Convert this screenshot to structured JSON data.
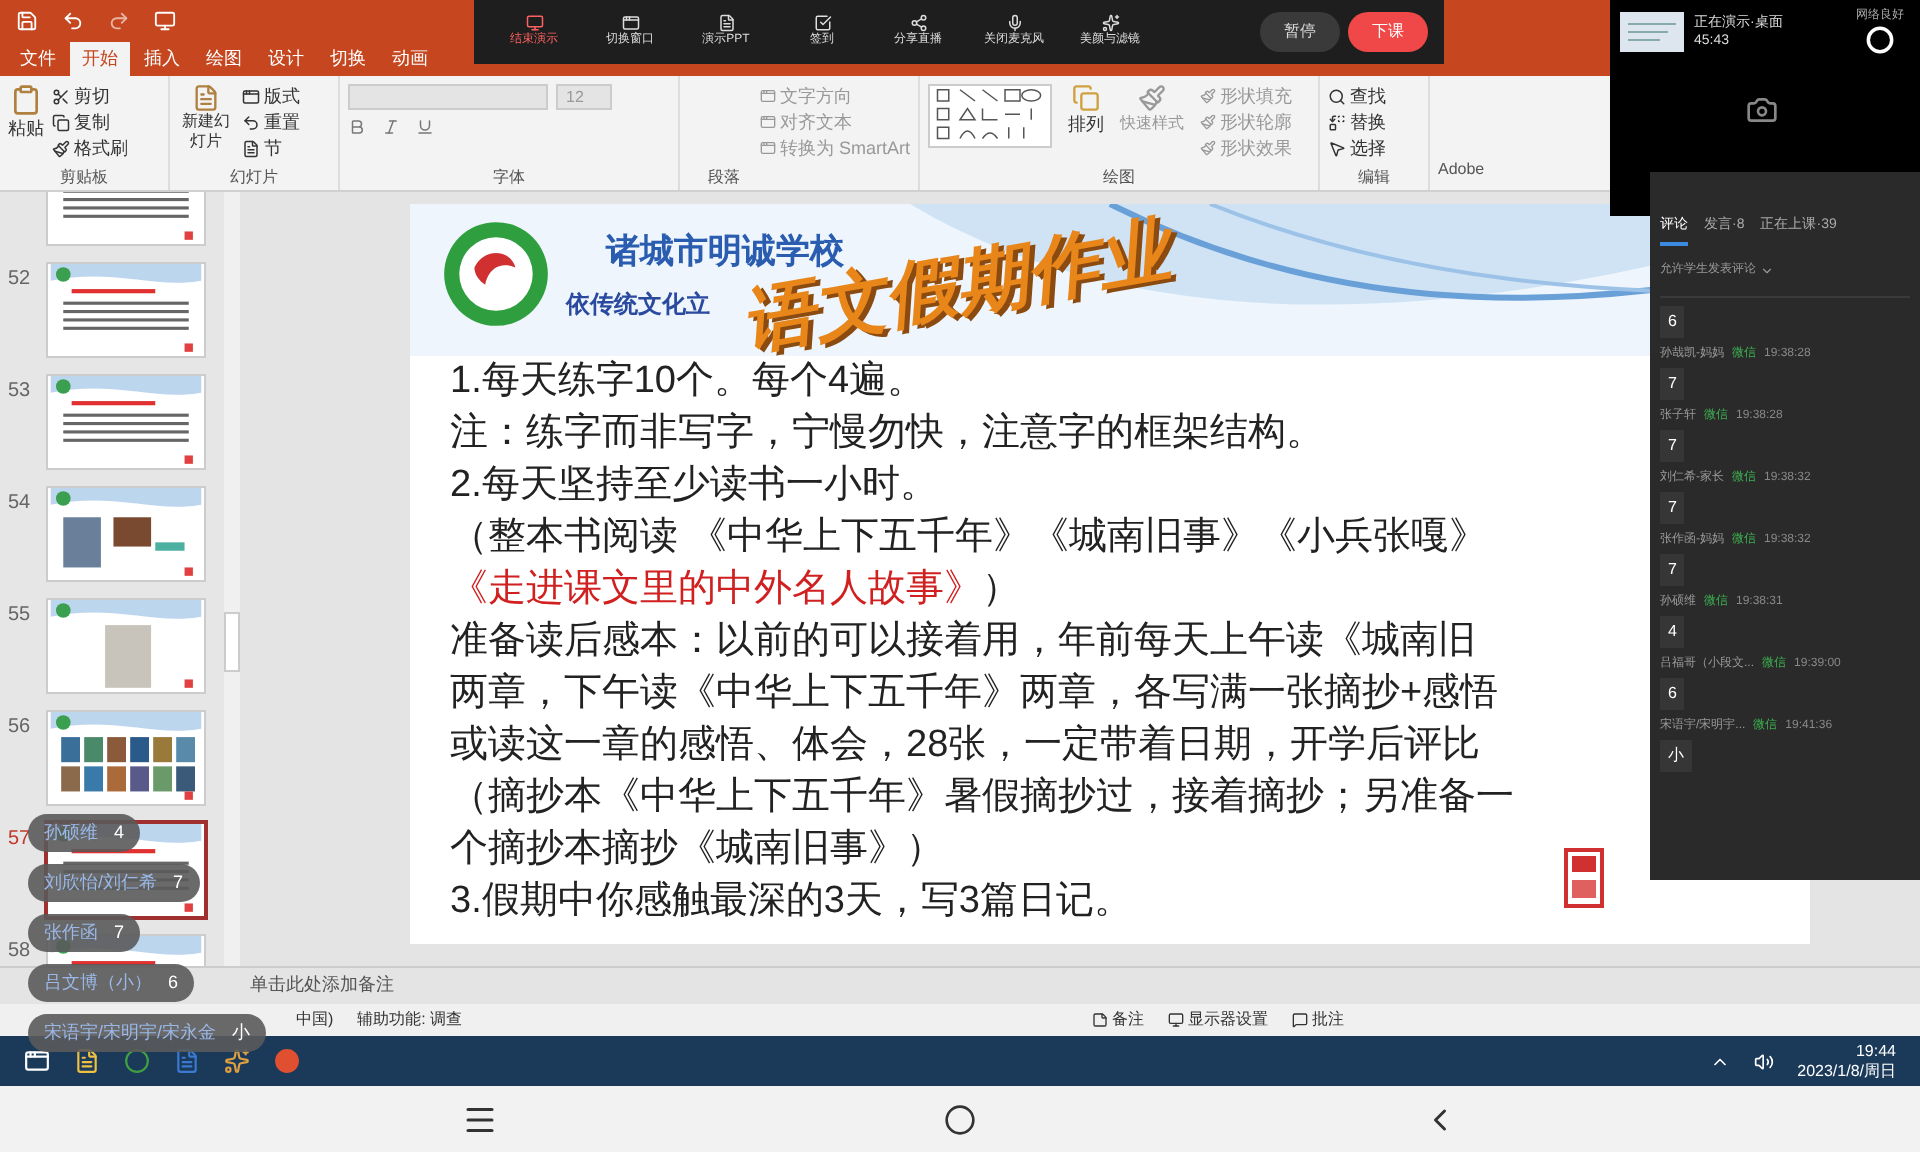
{
  "ribbon_tabs": [
    {
      "label": "文件",
      "selected": false
    },
    {
      "label": "开始",
      "selected": true
    },
    {
      "label": "插入",
      "selected": false
    },
    {
      "label": "绘图",
      "selected": false
    },
    {
      "label": "设计",
      "selected": false
    },
    {
      "label": "切换",
      "selected": false
    },
    {
      "label": "动画",
      "selected": false
    }
  ],
  "live_toolbar": {
    "buttons": [
      {
        "label": "结束演示",
        "kind": "alert"
      },
      {
        "label": "切换窗口",
        "kind": "normal"
      },
      {
        "label": "演示PPT",
        "kind": "normal"
      },
      {
        "label": "签到",
        "kind": "normal"
      },
      {
        "label": "分享直播",
        "kind": "normal"
      },
      {
        "label": "关闭麦克风",
        "kind": "normal"
      },
      {
        "label": "美颜与滤镜",
        "kind": "normal"
      }
    ],
    "pause": "暂停",
    "end_class": "下课"
  },
  "ribbon": {
    "clipboard": {
      "label": "剪贴板",
      "paste": "粘贴",
      "cut": "剪切",
      "copy": "复制",
      "format_painter": "格式刷"
    },
    "slides": {
      "label": "幻灯片",
      "new_slide": "新建幻灯片",
      "layout": "版式",
      "reset": "重置",
      "section": "节"
    },
    "font": {
      "label": "字体",
      "size": "12"
    },
    "paragraph": {
      "label": "段落",
      "text_direction": "文字方向",
      "align_text": "对齐文本",
      "smartart": "转换为 SmartArt"
    },
    "drawing": {
      "label": "绘图",
      "arrange": "排列",
      "quick_styles": "快速样式",
      "fill": "形状填充",
      "outline": "形状轮廓",
      "effects": "形状效果"
    },
    "editing": {
      "label": "编辑",
      "find": "查找",
      "replace": "替换",
      "select": "选择"
    },
    "adobe": "Adobe"
  },
  "thumbnails": [
    {
      "kind": "text",
      "selected": false
    },
    {
      "number": "52",
      "kind": "text",
      "selected": false
    },
    {
      "number": "53",
      "kind": "text",
      "selected": false
    },
    {
      "number": "54",
      "kind": "photo",
      "selected": false
    },
    {
      "number": "55",
      "kind": "table",
      "selected": false
    },
    {
      "number": "56",
      "kind": "gallery",
      "selected": false
    },
    {
      "number": "57",
      "kind": "text",
      "selected": true
    },
    {
      "number": "58",
      "kind": "text",
      "selected": false
    }
  ],
  "slide": {
    "school": "诸城市明诚学校",
    "motto": "依传统文化立",
    "title": "语文假期作业",
    "lines": [
      {
        "text": "1.每天练字10个。每个4遍。",
        "kind": "normal"
      },
      {
        "text": "注：练字而非写字，宁慢勿快，注意字的框架结构。",
        "kind": "normal"
      },
      {
        "text": "2.每天坚持至少读书一小时。",
        "kind": "normal"
      },
      {
        "text": "（整本书阅读 《中华上下五千年》《城南旧事》《小兵张嘎》",
        "kind": "normal"
      },
      {
        "text": "《走进课文里的中外名人故事》",
        "kind": "red",
        "tail": "）"
      },
      {
        "text": "准备读后感本：以前的可以接着用，年前每天上午读《城南旧",
        "kind": "normal"
      },
      {
        "text": "两章，下午读《中华上下五千年》两章，各写满一张摘抄+感悟",
        "kind": "normal"
      },
      {
        "text": "或读这一章的感悟、体会，28张，一定带着日期，开学后评比",
        "kind": "normal"
      },
      {
        "text": "（摘抄本《中华上下五千年》暑假摘抄过，接着摘抄；另准备一",
        "kind": "normal"
      },
      {
        "text": "个摘抄本摘抄《城南旧事》）",
        "kind": "normal"
      },
      {
        "text": "3.假期中你感触最深的3天，写3篇日记。",
        "kind": "normal"
      }
    ]
  },
  "notes_placeholder": "单击此处添加备注",
  "status_bar": {
    "language": "中国)",
    "accessibility": "辅助功能: 调查",
    "notes": "备注",
    "display": "显示器设置",
    "comments": "批注"
  },
  "taskbar": {
    "time": "19:44",
    "date": "2023/1/8/周日"
  },
  "presenter": {
    "status": "正在演示·桌面",
    "timer": "45:43",
    "network": "网络良好"
  },
  "comment_panel": {
    "tabs": [
      {
        "label": "评论",
        "selected": true
      },
      {
        "label": "发言·8",
        "selected": false
      },
      {
        "label": "正在上课·39",
        "selected": false
      }
    ],
    "filter": "允许学生发表评论",
    "comments": [
      {
        "text": "6"
      },
      {
        "name": "孙哉凯-妈妈",
        "tag": "微信",
        "time": "19:38:28",
        "text": "7"
      },
      {
        "name": "张子轩",
        "tag": "微信",
        "time": "19:38:28",
        "text": "7"
      },
      {
        "name": "刘仁希-家长",
        "tag": "微信",
        "time": "19:38:32",
        "text": "7"
      },
      {
        "name": "张作函-妈妈",
        "tag": "微信",
        "time": "19:38:32",
        "text": "7"
      },
      {
        "name": "孙硕维",
        "tag": "微信",
        "time": "19:38:31",
        "text": "4"
      },
      {
        "name": "吕福哥（小段文...",
        "tag": "微信",
        "time": "19:39:00",
        "text": "6"
      },
      {
        "name": "宋语宇/宋明宇...",
        "tag": "微信",
        "time": "19:41:36",
        "text": "小"
      }
    ]
  },
  "bubbles": [
    {
      "name": "孙硕维",
      "text": "4"
    },
    {
      "name": "刘欣怡/刘仁希",
      "text": "7"
    },
    {
      "name": "张作函",
      "text": "7"
    },
    {
      "name": "吕文博（小）",
      "text": "6"
    },
    {
      "name": "宋语宇/宋明宇/宋永金",
      "text": "小"
    }
  ]
}
